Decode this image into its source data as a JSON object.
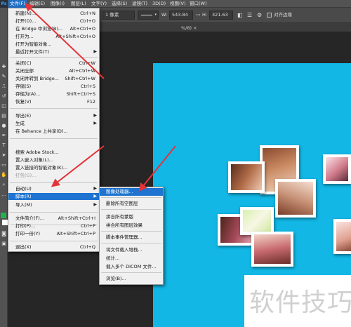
{
  "menubar": {
    "logo": "Ps",
    "items": [
      "文件(F)",
      "编辑(E)",
      "图像(I)",
      "图层(L)",
      "文字(Y)",
      "选择(S)",
      "滤镜(T)",
      "3D(D)",
      "视图(V)",
      "窗口(W)"
    ]
  },
  "options": {
    "stroke_width": "1 像素",
    "w_label": "W:",
    "w_value": "543.84",
    "h_label": "H:",
    "h_value": "321.63",
    "align_edges": "对齐边缘"
  },
  "doc_tab_fragment": "%/8) ×",
  "file_menu": {
    "items": [
      {
        "label": "新建(N)...",
        "shortcut": "Ctrl+N"
      },
      {
        "label": "打开(O)...",
        "shortcut": "Ctrl+O"
      },
      {
        "label": "在 Bridge 中浏览(B)...",
        "shortcut": "Alt+Ctrl+O"
      },
      {
        "label": "打开为...",
        "shortcut": "Alt+Shift+Ctrl+O"
      },
      {
        "label": "打开为智能对象...",
        "shortcut": ""
      },
      {
        "label": "最近打开文件(T)",
        "shortcut": "",
        "submenu": true
      },
      {
        "label": "关闭(C)",
        "shortcut": "Ctrl+W"
      },
      {
        "label": "关闭全部",
        "shortcut": "Alt+Ctrl+W"
      },
      {
        "label": "关闭并转到 Bridge...",
        "shortcut": "Shift+Ctrl+W"
      },
      {
        "label": "存储(S)",
        "shortcut": "Ctrl+S"
      },
      {
        "label": "存储为(A)...",
        "shortcut": "Shift+Ctrl+S"
      },
      {
        "label": "恢复(V)",
        "shortcut": "F12"
      },
      {
        "label": "导出(E)",
        "shortcut": "",
        "submenu": true
      },
      {
        "label": "生成",
        "shortcut": "",
        "submenu": true
      },
      {
        "label": "在 Behance 上共享(D)...",
        "shortcut": ""
      },
      {
        "label": "搜索 Adobe Stock...",
        "shortcut": ""
      },
      {
        "label": "置入嵌入对象(L)...",
        "shortcut": ""
      },
      {
        "label": "置入链接的智能对象(K)...",
        "shortcut": ""
      },
      {
        "label": "打包(G)...",
        "shortcut": "",
        "disabled": true
      },
      {
        "label": "自动(U)",
        "shortcut": "",
        "submenu": true
      },
      {
        "label": "脚本(R)",
        "shortcut": "",
        "submenu": true,
        "highlight": true
      },
      {
        "label": "导入(M)",
        "shortcut": "",
        "submenu": true
      },
      {
        "label": "文件简介(F)...",
        "shortcut": "Alt+Shift+Ctrl+I"
      },
      {
        "label": "打印(P)...",
        "shortcut": "Ctrl+P"
      },
      {
        "label": "打印一份(Y)",
        "shortcut": "Alt+Shift+Ctrl+P"
      },
      {
        "label": "退出(X)",
        "shortcut": "Ctrl+Q"
      }
    ]
  },
  "script_menu": {
    "items": [
      {
        "label": "图像处理器...",
        "highlight": true
      },
      {
        "label": "删除所有空图层"
      },
      {
        "label": "拼合所有蒙版"
      },
      {
        "label": "拼合所有图层效果"
      },
      {
        "label": "脚本事件管理器..."
      },
      {
        "label": "将文件载入堆栈..."
      },
      {
        "label": "统计..."
      },
      {
        "label": "载入多个 DICOM 文件..."
      },
      {
        "label": "浏览(B)..."
      }
    ]
  },
  "watermark": "软件技巧",
  "colors": {
    "canvas": "#12b7e5",
    "highlight": "#1e74d0",
    "arrow": "#e3343a",
    "foreground_swatch": "#22b14c"
  }
}
